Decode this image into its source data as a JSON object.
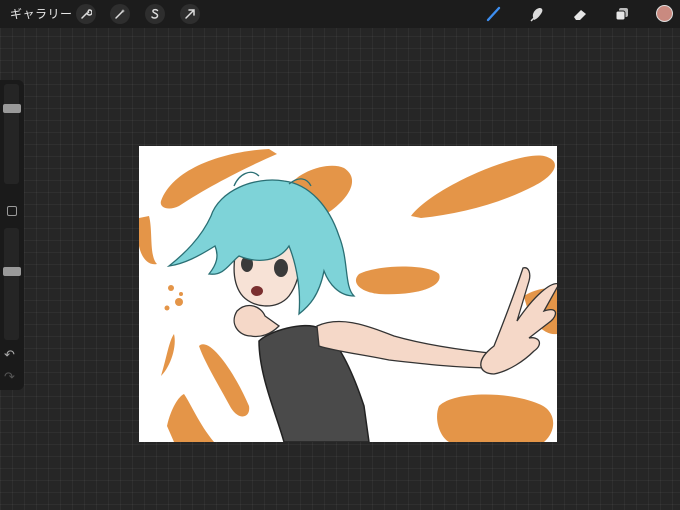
{
  "topbar": {
    "gallery_label": "ギャラリー",
    "left_tools": [
      "wrench-icon",
      "magic-wand-icon",
      "selection-icon",
      "transform-arrow-icon"
    ],
    "right_tools": [
      "brush-icon",
      "smudge-icon",
      "eraser-icon",
      "layers-icon"
    ],
    "active_tool": "brush-icon",
    "current_color": "#c98a80",
    "accent": "#3d8ef0"
  },
  "sidebar": {
    "brush_size_level": 0.78,
    "opacity_level": 0.62,
    "controls": [
      "modify-button",
      "undo-icon",
      "redo-icon"
    ]
  },
  "canvas": {
    "background": "#ffffff",
    "artwork": "anime-girl-reaching-out-orange-brush-strokes",
    "stroke_color": "#e49548",
    "hair_color": "#7ed3d8",
    "dress_color": "#4a4a4a"
  }
}
